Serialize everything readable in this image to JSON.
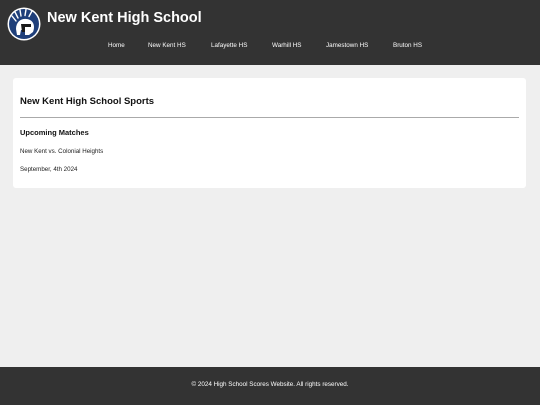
{
  "header": {
    "title": "New Kent High School",
    "logo_icon": "trojan-helmet-logo-icon",
    "background": "#333333"
  },
  "nav": {
    "items": [
      {
        "label": "Home"
      },
      {
        "label": "New Kent HS"
      },
      {
        "label": "Lafayette HS"
      },
      {
        "label": "Warhill HS"
      },
      {
        "label": "Jamestown HS"
      },
      {
        "label": "Bruton HS"
      }
    ]
  },
  "main": {
    "title": "New Kent High School Sports",
    "upcoming": {
      "heading": "Upcoming Matches",
      "matches": [
        {
          "teams": "New Kent vs. Colonial Heights",
          "date": "September, 4th 2024"
        }
      ]
    }
  },
  "footer": {
    "text": "© 2024 High School Scores Website. All rights reserved."
  }
}
